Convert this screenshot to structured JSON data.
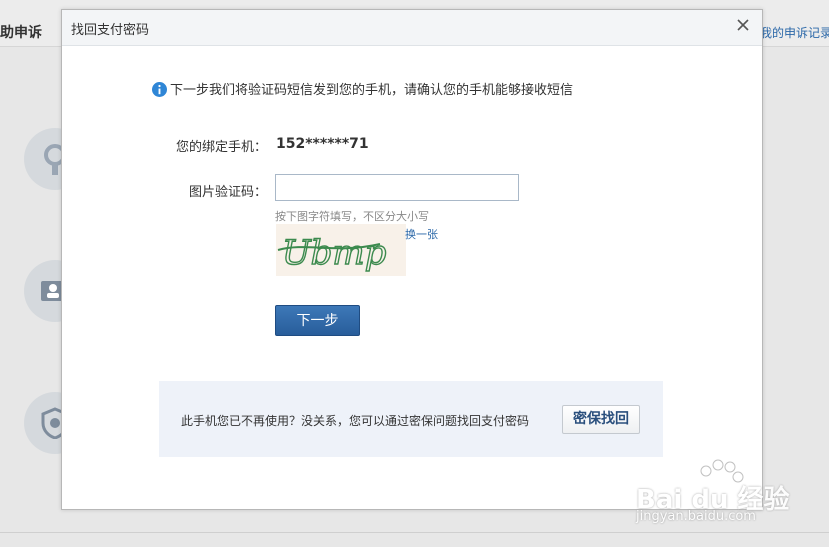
{
  "background": {
    "left_title": "自助申诉",
    "right_link": "我的申诉记录"
  },
  "dialog": {
    "title": "找回支付密码",
    "notice": "下一步我们将验证码短信发到您的手机，请确认您的手机能够接收短信",
    "phone_label": "您的绑定手机：",
    "phone_value": "152******71",
    "captcha_label": "图片验证码：",
    "captcha_input_value": "",
    "captcha_hint": "按下图字符填写，不区分大小写",
    "captcha_text": "Ubmp",
    "refresh_label": "换一张",
    "next_button": "下一步",
    "panel": {
      "text": "此手机您已不再使用？没关系，您可以通过密保问题找回支付密码",
      "button": "密保找回"
    }
  },
  "watermark": {
    "brand": "Bai du 经验",
    "url": "jingyan.baidu.com"
  },
  "colors": {
    "accent": "#2a67a8",
    "primary_button": "#316aab",
    "panel_bg": "#eef2f9"
  }
}
